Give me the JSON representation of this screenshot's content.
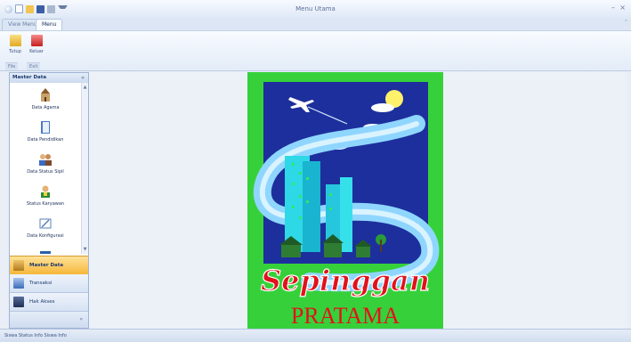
{
  "window": {
    "title": "Menu Utama",
    "minimize_icon": "minimize-icon",
    "close_icon": "close-icon"
  },
  "quick_access": [
    "app-menu-icon",
    "new-icon",
    "open-icon",
    "save-icon",
    "print-icon",
    "dropdown-icon"
  ],
  "ribbon": {
    "tabs": [
      {
        "label": "View Menu"
      },
      {
        "label": "Menu"
      }
    ],
    "buttons": [
      {
        "label": "Tutup",
        "icon": "folder-icon"
      },
      {
        "label": "Keluar",
        "icon": "exit-icon"
      }
    ],
    "groups": [
      "File",
      "Exit"
    ]
  },
  "nav": {
    "header": "Master Data",
    "items": [
      {
        "label": "Data Agama",
        "icon": "agama-icon"
      },
      {
        "label": "Data Pendidikan",
        "icon": "book-icon"
      },
      {
        "label": "Data Status Sipil",
        "icon": "people-icon"
      },
      {
        "label": "Status Karyawan",
        "icon": "employee-icon"
      },
      {
        "label": "Data Konfigurasi",
        "icon": "config-icon"
      }
    ],
    "sections": [
      {
        "label": "Master Data",
        "icon": "master-data-icon"
      },
      {
        "label": "Transaksi",
        "icon": "transaksi-icon"
      },
      {
        "label": "Hak Akses",
        "icon": "user-access-icon"
      }
    ]
  },
  "logo": {
    "script_text": "Sepinggan",
    "bottom_text": "PRATAMA"
  },
  "status": {
    "text": "Siswa Status Info  Siswa Info"
  },
  "colors": {
    "ribbon_bg": "#e3ecf8",
    "nav_selected": "#fbc24a",
    "logo_green": "#36d13a",
    "logo_blue": "#1d2f9c",
    "logo_red": "#e1121b"
  }
}
